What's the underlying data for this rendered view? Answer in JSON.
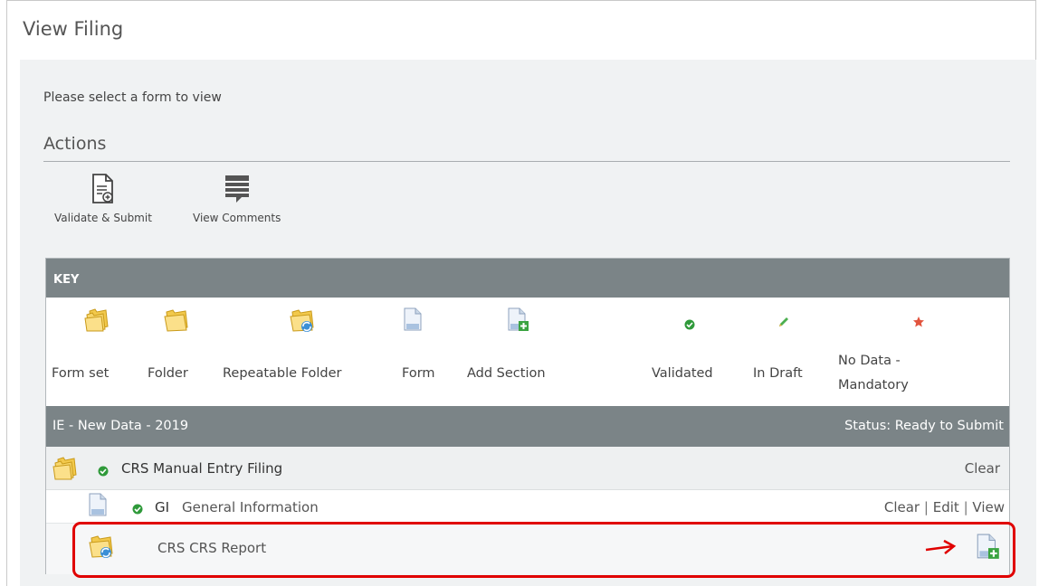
{
  "page": {
    "title": "View Filing",
    "instruction": "Please select a form to view"
  },
  "actions": {
    "title": "Actions",
    "items": [
      {
        "label": "Validate & Submit",
        "icon": "validate-submit-icon"
      },
      {
        "label": "View Comments",
        "icon": "comments-icon"
      }
    ]
  },
  "key": {
    "title": "KEY",
    "items": [
      {
        "label": "Form set",
        "icon": "form-set-icon"
      },
      {
        "label": "Folder",
        "icon": "folder-icon"
      },
      {
        "label": "Repeatable Folder",
        "icon": "repeatable-folder-icon"
      },
      {
        "label": "Form",
        "icon": "form-icon"
      },
      {
        "label": "Add Section",
        "icon": "add-section-icon"
      },
      {
        "label": "Validated",
        "icon": "validated-icon"
      },
      {
        "label": "In Draft",
        "icon": "in-draft-icon"
      },
      {
        "label": "No Data -",
        "label2": "Mandatory",
        "icon": "no-data-mandatory-icon"
      }
    ]
  },
  "filing": {
    "name": "IE - New Data - 2019",
    "status": "Status: Ready to Submit",
    "rows": [
      {
        "name": "CRS Manual Entry Filing",
        "actions": [
          "Clear"
        ]
      },
      {
        "code": "GI",
        "name": "General Information",
        "actions": [
          "Clear",
          "Edit",
          "View"
        ]
      },
      {
        "name": "CRS CRS Report"
      }
    ]
  },
  "colors": {
    "header_bg": "#7b8487",
    "highlight": "#e00000",
    "validated": "#2f9a3a"
  }
}
